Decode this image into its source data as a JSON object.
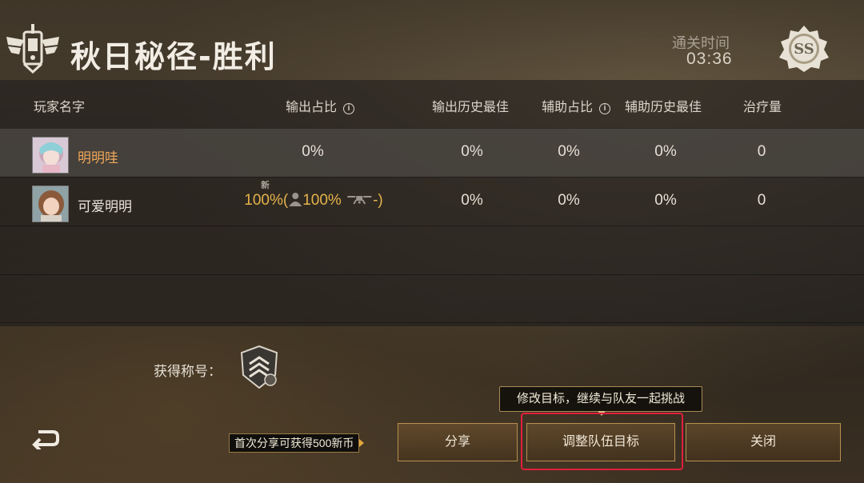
{
  "header": {
    "title": "秋日秘径-胜利",
    "clear_time_label": "通关时间",
    "clear_time_value": "03:36",
    "rank": "SS"
  },
  "table": {
    "columns": {
      "player": "玩家名字",
      "output_ratio": "输出占比",
      "output_best": "输出历史最佳",
      "assist_ratio": "辅助占比",
      "assist_best": "辅助历史最佳",
      "healing": "治疗量"
    },
    "rows": [
      {
        "name": "明明哇",
        "output_ratio": "0%",
        "output_best": "0%",
        "assist_ratio": "0%",
        "assist_best": "0%",
        "healing": "0"
      },
      {
        "name": "可爱明明",
        "new_tag": "新",
        "output_ratio_prefix": "100%(",
        "output_ratio_mid": "100%",
        "output_ratio_suffix": "-)",
        "output_best": "0%",
        "assist_ratio": "0%",
        "assist_best": "0%",
        "healing": "0"
      }
    ]
  },
  "footer": {
    "title_label": "获得称号：",
    "tooltip": "修改目标，继续与队友一起挑战",
    "share_hint": "首次分享可获得500新币",
    "buttons": {
      "share": "分享",
      "adjust": "调整队伍目标",
      "close": "关闭"
    }
  },
  "colors": {
    "accent_gold": "#e5b34c",
    "self_name": "#f0a85a",
    "button_border": "#b8904e",
    "highlight": "#e0203a"
  },
  "icons": {
    "emblem": "winged-badge-icon",
    "rank": "ss-rank-icon",
    "info": "info-icon",
    "person": "person-icon",
    "drone": "drone-icon",
    "title_badge": "chevron-shield-icon",
    "back": "back-arrow-icon"
  }
}
